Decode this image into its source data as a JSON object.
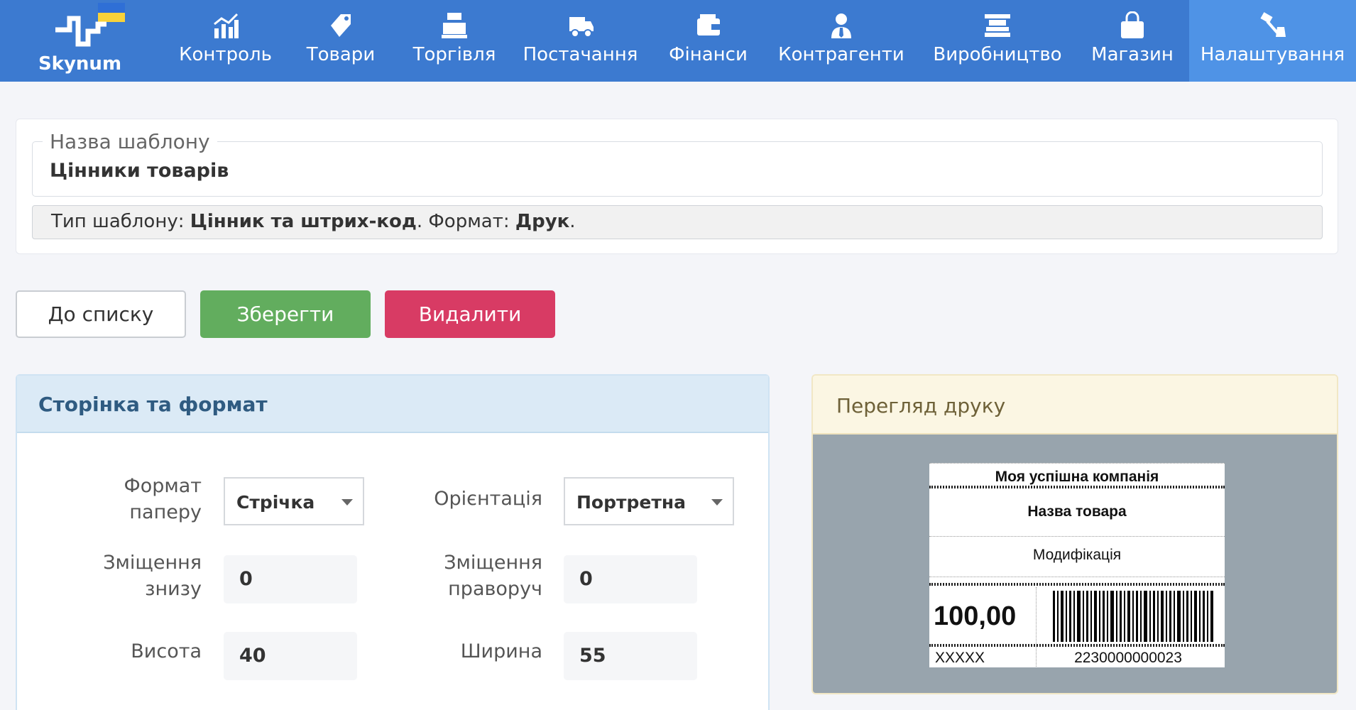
{
  "brand": {
    "name": "Skynum"
  },
  "nav": [
    {
      "label": "Контроль",
      "icon": "chart-icon"
    },
    {
      "label": "Товари",
      "icon": "tags-icon"
    },
    {
      "label": "Торгівля",
      "icon": "cash-register-icon"
    },
    {
      "label": "Постачання",
      "icon": "truck-icon"
    },
    {
      "label": "Фінанси",
      "icon": "wallet-icon"
    },
    {
      "label": "Контрагенти",
      "icon": "user-tie-icon"
    },
    {
      "label": "Виробництво",
      "icon": "factory-icon"
    },
    {
      "label": "Магазин",
      "icon": "shopping-bag-icon"
    },
    {
      "label": "Налаштування",
      "icon": "tools-icon",
      "active": true
    }
  ],
  "template": {
    "name_legend": "Назва шаблону",
    "name_value": "Цінники товарів",
    "type_prefix": "Тип шаблону: ",
    "type_value": "Цінник та штрих-код",
    "format_prefix": ". Формат: ",
    "format_value": "Друк",
    "suffix": "."
  },
  "buttons": {
    "to_list": "До списку",
    "save": "Зберегти",
    "delete": "Видалити"
  },
  "page_format": {
    "title": "Сторінка та формат",
    "paper_format_label_1": "Формат",
    "paper_format_label_2": "паперу",
    "paper_format_value": "Стрічка",
    "orientation_label": "Орієнтація",
    "orientation_value": "Портретна",
    "offset_bottom_label_1": "Зміщення",
    "offset_bottom_label_2": "знизу",
    "offset_bottom_value": "0",
    "offset_right_label_1": "Зміщення",
    "offset_right_label_2": "праворуч",
    "offset_right_value": "0",
    "height_label": "Висота",
    "height_value": "40",
    "width_label": "Ширина",
    "width_value": "55"
  },
  "preview": {
    "title": "Перегляд друку",
    "company": "Моя успішна компанія",
    "product_name": "Назва товара",
    "modification": "Модифікація",
    "price": "100,00",
    "sku": "XXXXX",
    "barcode_number": "2230000000023"
  },
  "colors": {
    "topbar": "#3c7ad0",
    "active_nav": "#4f93e6",
    "save": "#62ad5e",
    "delete": "#d83b64"
  }
}
